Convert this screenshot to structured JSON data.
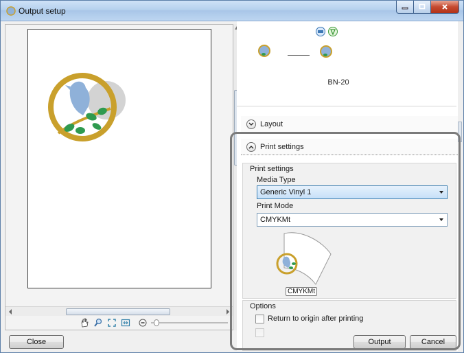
{
  "window": {
    "title": "Output setup"
  },
  "preview": {
    "printer_name": "BN-20"
  },
  "sections": {
    "layout_title": "Layout",
    "print_settings_title": "Print settings"
  },
  "print_settings": {
    "group_title": "Print settings",
    "media_type_label": "Media Type",
    "media_type_value": "Generic Vinyl 1",
    "print_mode_label": "Print Mode",
    "print_mode_value": "CMYKMt",
    "mode_badge": "CMYKMt"
  },
  "options": {
    "group_title": "Options",
    "return_to_origin_label": "Return to origin after printing"
  },
  "buttons": {
    "close": "Close",
    "output": "Output",
    "cancel": "Cancel"
  },
  "icons": {
    "app": "app-icon",
    "hand": "hand-tool-icon",
    "zoom": "zoom-icon",
    "fit": "fit-to-window-icon",
    "actual": "actual-size-icon",
    "zoom_out": "zoom-out-icon",
    "cut": "cut-icon",
    "print": "print-icon"
  },
  "colors": {
    "bird": "#8fb1d9",
    "ring": "#c9a02c",
    "leaf": "#2f9a4f",
    "accent_border": "#7b7b7b"
  }
}
